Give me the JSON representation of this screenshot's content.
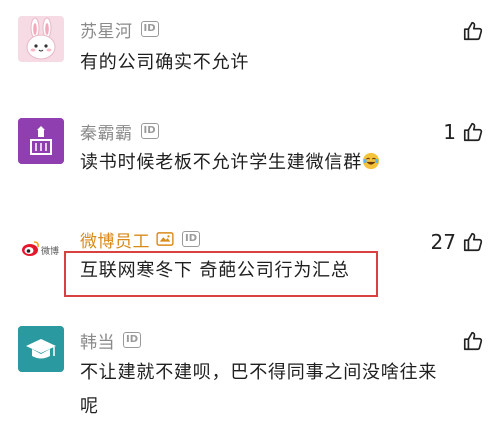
{
  "comments": [
    {
      "username": "苏星河",
      "badge": "ID",
      "text": "有的公司确实不允许",
      "likes": "",
      "avatar": "bunny-avatar"
    },
    {
      "username": "秦霸霸",
      "badge": "ID",
      "text": "读书时候老板不允许学生建微信群",
      "likes": "1",
      "avatar": "purple-building-avatar"
    },
    {
      "username": "微博员工",
      "badge": "ID",
      "text": "互联网寒冬下 奇葩公司行为汇总",
      "likes": "27",
      "avatar": "weibo-logo-avatar",
      "avatar_label": "微博"
    },
    {
      "username": "韩当",
      "badge": "ID",
      "text": "不让建就不建呗，巴不得同事之间没啥往来呢",
      "likes": "",
      "avatar": "graduation-cap-avatar"
    }
  ],
  "colors": {
    "username": "#8a8a8a",
    "official_username": "#d98a1a",
    "highlight_border": "#d94040",
    "purple_avatar": "#8f3fb0",
    "teal_avatar": "#2a9aa0"
  }
}
